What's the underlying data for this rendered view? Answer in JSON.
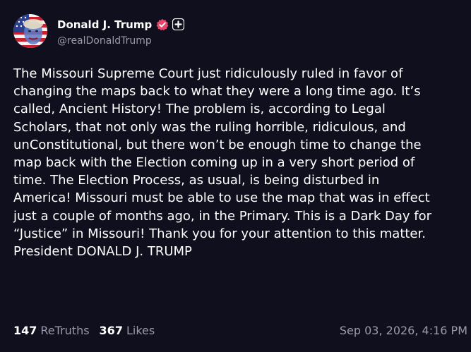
{
  "author": {
    "display_name": "Donald J. Trump",
    "handle": "@realDonaldTrump",
    "verified_icon": "verified-badge-icon",
    "plus_icon": "plus-badge-icon",
    "avatar_icon": "avatar-flag-face"
  },
  "post": {
    "lines": [
      "The Missouri Supreme Court just ridiculously ruled in favor of",
      "changing the maps back to what they were a long time ago. It’s",
      "called, Ancient History! The problem is, according to Legal",
      "Scholars, that not only was the ruling horrible, ridiculous, and",
      "unConstitutional, but there won’t be enough time to change the",
      "map back with the Election coming up in a very short period of",
      "time. The Election Process, as usual, is being disturbed in",
      "America! Missouri must be able to use the map that was in effect",
      "just a couple of months ago, in the Primary. This is a Dark Day for",
      "“Justice” in Missouri! Thank you for your attention to this matter.",
      "President DONALD J. TRUMP"
    ]
  },
  "stats": {
    "retruths_count": "147",
    "retruths_label": "ReTruths",
    "likes_count": "367",
    "likes_label": "Likes"
  },
  "timestamp": "Sep 03, 2026, 4:16 PM",
  "colors": {
    "background": "#0f0f1e",
    "text": "#ffffff",
    "muted": "#9a9aaa",
    "verified": "#e8456b"
  }
}
